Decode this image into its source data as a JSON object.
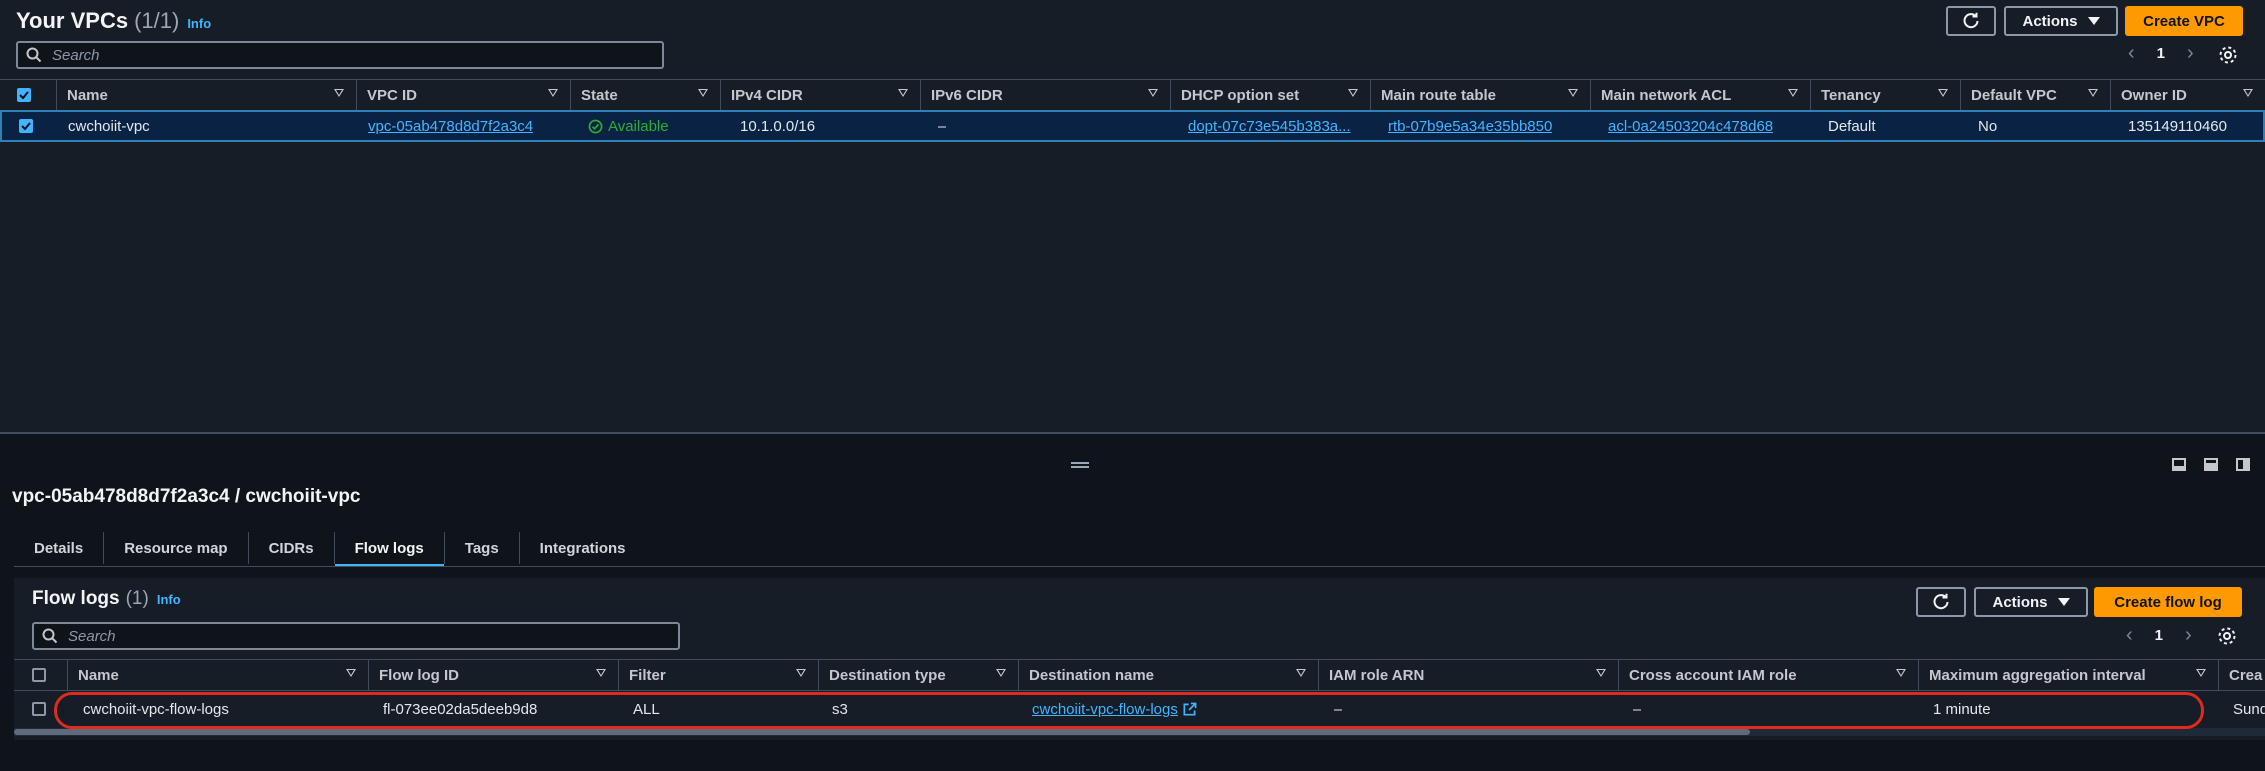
{
  "vpcs": {
    "title": "Your VPCs",
    "count": "(1/1)",
    "info": "Info",
    "actions_label": "Actions",
    "create_label": "Create VPC",
    "search_placeholder": "Search",
    "page": "1",
    "columns": [
      "Name",
      "VPC ID",
      "State",
      "IPv4 CIDR",
      "IPv6 CIDR",
      "DHCP option set",
      "Main route table",
      "Main network ACL",
      "Tenancy",
      "Default VPC",
      "Owner ID"
    ],
    "row": {
      "name": "cwchoiit-vpc",
      "vpc_id": "vpc-05ab478d8d7f2a3c4",
      "state": "Available",
      "ipv4": "10.1.0.0/16",
      "ipv6": "–",
      "dhcp": "dopt-07c73e545b383a...",
      "route_table": "rtb-07b9e5a34e35bb850",
      "acl": "acl-0a24503204c478d68",
      "tenancy": "Default",
      "default_vpc": "No",
      "owner": "135149110460"
    }
  },
  "detail": {
    "title": "vpc-05ab478d8d7f2a3c4 / cwchoiit-vpc",
    "tabs": [
      "Details",
      "Resource map",
      "CIDRs",
      "Flow logs",
      "Tags",
      "Integrations"
    ],
    "active_tab": "Flow logs"
  },
  "flowlogs": {
    "title": "Flow logs",
    "count": "(1)",
    "info": "Info",
    "actions_label": "Actions",
    "create_label": "Create flow log",
    "search_placeholder": "Search",
    "page": "1",
    "columns": [
      "Name",
      "Flow log ID",
      "Filter",
      "Destination type",
      "Destination name",
      "IAM role ARN",
      "Cross account IAM role",
      "Maximum aggregation interval",
      "Crea"
    ],
    "row": {
      "name": "cwchoiit-vpc-flow-logs",
      "id": "fl-073ee02da5deeb9d8",
      "filter": "ALL",
      "dest_type": "s3",
      "dest_name": "cwchoiit-vpc-flow-logs",
      "iam_role": "–",
      "cross_account": "–",
      "interval": "1 minute",
      "created": "Sund"
    }
  },
  "colors": {
    "accent": "#ff9900",
    "link": "#42b4ff",
    "success": "#29ad32",
    "highlight": "#dd2b1f"
  }
}
